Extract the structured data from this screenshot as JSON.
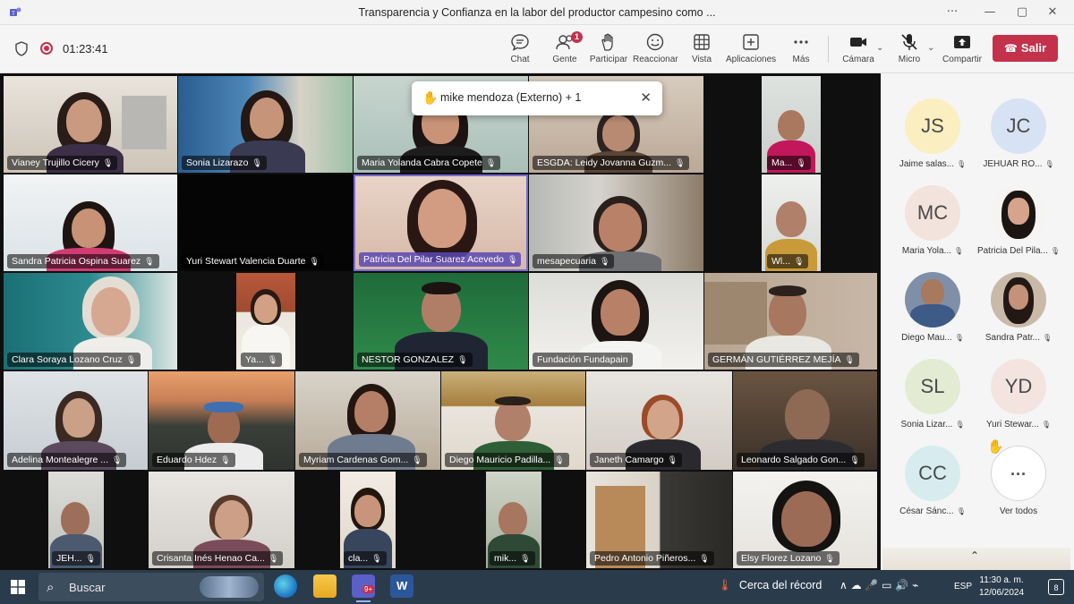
{
  "window": {
    "title": "Transparencia y Confianza en la labor del productor campesino como ...",
    "controls": [
      "···",
      "—",
      "▢",
      "✕"
    ]
  },
  "toolbar": {
    "timer": "01:23:41",
    "buttons": [
      {
        "label": "Chat",
        "icon": "chat-icon"
      },
      {
        "label": "Gente",
        "icon": "people-icon",
        "badge": "1"
      },
      {
        "label": "Participar",
        "icon": "raise-hand-icon"
      },
      {
        "label": "Reaccionar",
        "icon": "smile-icon"
      },
      {
        "label": "Vista",
        "icon": "grid-icon"
      },
      {
        "label": "Aplicaciones",
        "icon": "apps-icon"
      },
      {
        "label": "Más",
        "icon": "more-icon"
      },
      {
        "label": "Cámara",
        "icon": "camera-icon"
      },
      {
        "label": "Micro",
        "icon": "mic-off-icon"
      },
      {
        "label": "Compartir",
        "icon": "share-icon"
      }
    ],
    "leave_label": "Salir"
  },
  "notification": {
    "text": "mike mendoza (Externo) + 1"
  },
  "tiles": [
    {
      "name": "Vianey Trujillo Cicery"
    },
    {
      "name": "Sonia Lizarazo"
    },
    {
      "name": "Maria Yolanda Cabra Copete"
    },
    {
      "name": "ESGDA: Leidy Jovanna Guzm..."
    },
    {
      "name": "Ma..."
    },
    {
      "name": "Sandra Patricia Ospina Suarez"
    },
    {
      "name": "Yuri Stewart Valencia Duarte"
    },
    {
      "name": "Patricia Del Pilar Suarez Acevedo"
    },
    {
      "name": "mesapecuaria"
    },
    {
      "name": "Wl..."
    },
    {
      "name": "Clara Soraya Lozano Cruz"
    },
    {
      "name": "Ya..."
    },
    {
      "name": "NESTOR GONZALEZ"
    },
    {
      "name": "Fundación Fundapain"
    },
    {
      "name": "GERMÁN GUTIÉRREZ MEJÍA"
    },
    {
      "name": "Adelina Montealegre ..."
    },
    {
      "name": "Eduardo Hdez"
    },
    {
      "name": "Myriam Cardenas Gom..."
    },
    {
      "name": "Diego Mauricio Padilla..."
    },
    {
      "name": "Janeth Camargo"
    },
    {
      "name": "Leonardo Salgado Gon..."
    },
    {
      "name": "JEH..."
    },
    {
      "name": "Crisanta Inés Henao Ca..."
    },
    {
      "name": "cla..."
    },
    {
      "name": "mik..."
    },
    {
      "name": "Pedro Antonio Piñeros..."
    },
    {
      "name": "Elsy Florez Lozano"
    }
  ],
  "roster": [
    {
      "initials": "JS",
      "name": "Jaime salas...",
      "color": "#fbeec0"
    },
    {
      "initials": "JC",
      "name": "JEHUAR RO...",
      "color": "#d7e2f5"
    },
    {
      "initials": "MC",
      "name": "Maria Yola...",
      "color": "#f2e3dc"
    },
    {
      "initials": "",
      "name": "Patricia Del Pila...",
      "color": "#e8d8cf"
    },
    {
      "initials": "",
      "name": "Diego Mau...",
      "color": "#7f8fa8"
    },
    {
      "initials": "",
      "name": "Sandra Patr...",
      "color": "#c9b9a8"
    },
    {
      "initials": "SL",
      "name": "Sonia Lizar...",
      "color": "#e3ecd3"
    },
    {
      "initials": "YD",
      "name": "Yuri Stewar...",
      "color": "#f3e4e0"
    },
    {
      "initials": "CC",
      "name": "César Sánc...",
      "color": "#d7ecee"
    },
    {
      "initials": "···",
      "name": "Ver todos",
      "color": "#ffffff"
    }
  ],
  "taskbar": {
    "search": "Buscar",
    "weather": "Cerca del récord",
    "tray": "∧ ☁ 🎤 ▭ 🔊 ⌁",
    "lang": "ESP",
    "time": "11:30 a. m.",
    "date": "12/06/2024",
    "notifications": "8"
  }
}
